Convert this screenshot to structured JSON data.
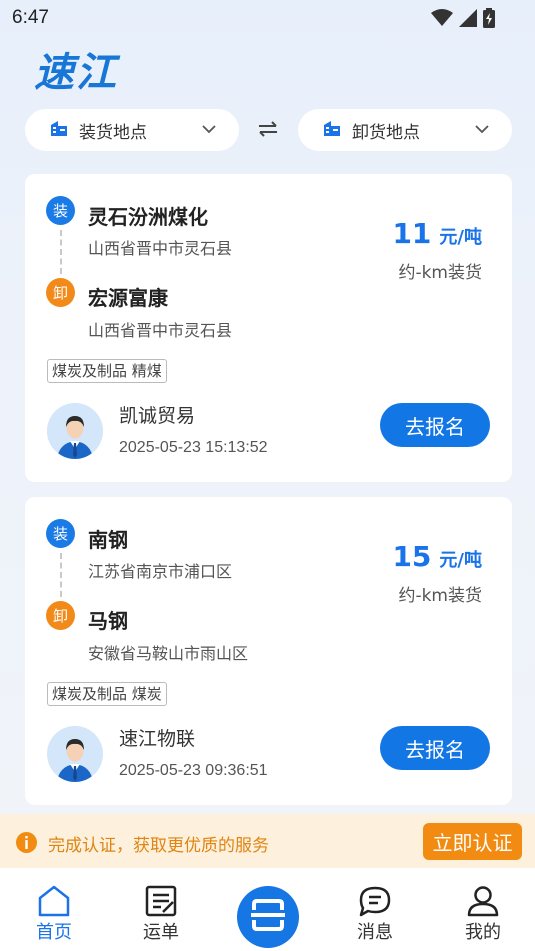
{
  "status_bar": {
    "time": "6:47",
    "icons": [
      "wifi-icon",
      "signal-icon",
      "battery-icon"
    ]
  },
  "app": {
    "logo": "速江"
  },
  "filters": {
    "load_location": "装货地点",
    "unload_location": "卸货地点",
    "swap_icon": "swap-icon"
  },
  "orders": [
    {
      "load_badge": "装",
      "load_name": "灵石汾洲煤化",
      "load_address": "山西省晋中市灵石县",
      "unload_badge": "卸",
      "unload_name": "宏源富康",
      "unload_address": "山西省晋中市灵石县",
      "price": "11",
      "price_unit": "元/吨",
      "price_sub": "约-km装货",
      "tag": "煤炭及制品 精煤",
      "company": "凯诚贸易",
      "time": "2025-05-23 15:13:52",
      "button": "去报名"
    },
    {
      "load_badge": "装",
      "load_name": "南钢",
      "load_address": "江苏省南京市浦口区",
      "unload_badge": "卸",
      "unload_name": "马钢",
      "unload_address": "安徽省马鞍山市雨山区",
      "price": "15",
      "price_unit": "元/吨",
      "price_sub": "约-km装货",
      "tag": "煤炭及制品 煤炭",
      "company": "速江物联",
      "time": "2025-05-23 09:36:51",
      "button": "去报名"
    }
  ],
  "notice": {
    "text": "完成认证，获取更优质的服务",
    "button": "立即认证"
  },
  "nav": {
    "home": "首页",
    "waybill": "运单",
    "message": "消息",
    "mine": "我的"
  },
  "colors": {
    "primary": "#1276e4",
    "accent": "#f28a1a",
    "notice_bg": "#fdf0dc"
  }
}
